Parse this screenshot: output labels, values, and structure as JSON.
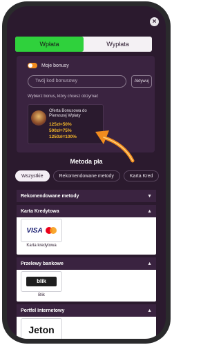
{
  "tabs": {
    "deposit": "Wpłata",
    "withdraw": "Wypłata"
  },
  "bonus": {
    "toggle_label": "Moje bonusy",
    "code_placeholder": "Twój kod bonusowy",
    "activate_label": "Aktywuj",
    "hint": "Wybierz bonus, który chcesz otrzymać",
    "card_title": "Oferta Bonusowa do Pierwszej Wpłaty",
    "lines": [
      "125zł=50%",
      "500zł=75%",
      "1250zł=100%"
    ]
  },
  "methods_title": "Metoda pła",
  "filters": [
    "Wszystkie",
    "Rekomendowane metody",
    "Karta Kred"
  ],
  "categories": {
    "recommended": "Rekomendowane metody",
    "card": "Karta Kredytowa",
    "card_item": "Karta kredytowa",
    "bank": "Przelewy bankowe",
    "bank_item": "Blik",
    "wallet": "Portfel Internetowy",
    "blik_logo": "blik",
    "visa_logo": "VISA",
    "jeton_logo": "Jeton"
  },
  "colors": {
    "accent_green": "#2fd13c",
    "bonus_yellow": "#f6b82a",
    "arrow_orange": "#f28c1e",
    "background": "#2b1a2e"
  }
}
